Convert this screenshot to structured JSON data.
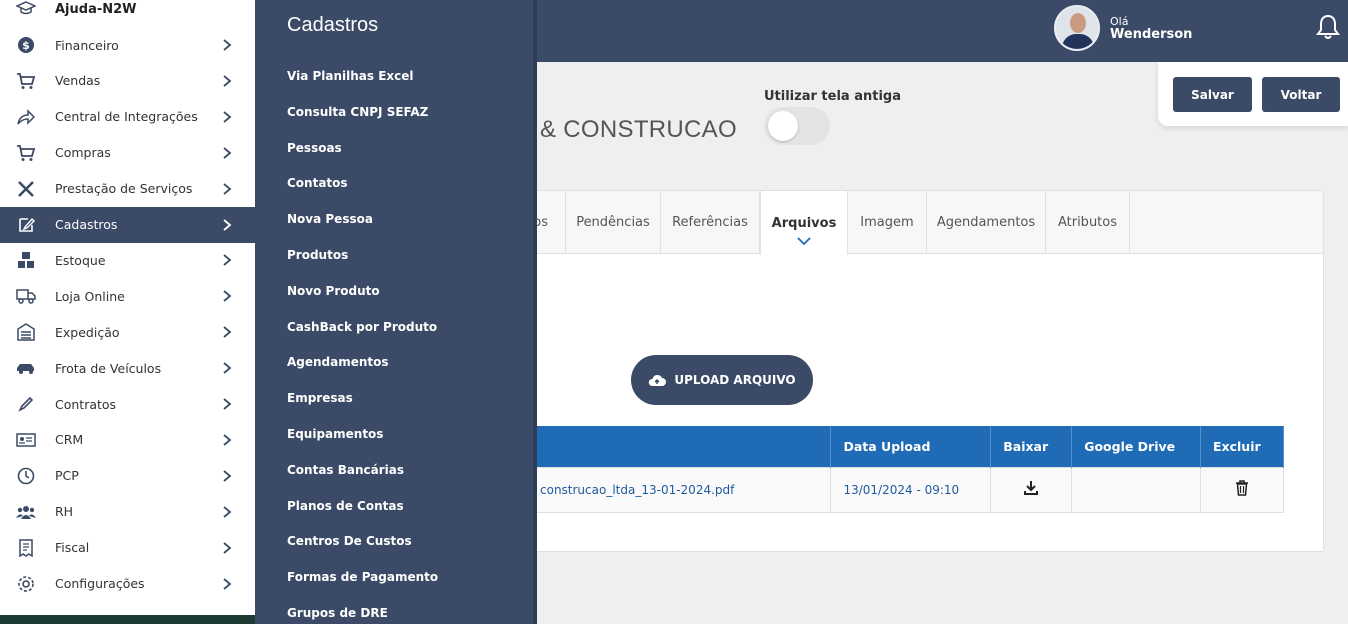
{
  "header": {
    "greeting": "Olá",
    "user_name": "Wenderson"
  },
  "actions": {
    "save_label": "Salvar",
    "back_label": "Voltar"
  },
  "page": {
    "company_title": "& CONSTRUCAO",
    "old_screen_label": "Utilizar tela antiga",
    "old_screen_enabled": false
  },
  "tabs": [
    {
      "label": "os"
    },
    {
      "label": "Pendências"
    },
    {
      "label": "Referências"
    },
    {
      "label": "Arquivos",
      "active": true
    },
    {
      "label": "Imagem"
    },
    {
      "label": "Agendamentos"
    },
    {
      "label": "Atributos"
    }
  ],
  "files": {
    "upload_label": "UPLOAD ARQUIVO",
    "columns": [
      "",
      "Data Upload",
      "Baixar",
      "Google Drive",
      "Excluir"
    ],
    "rows": [
      {
        "name": "construcao_ltda_13-01-2024.pdf",
        "date": "13/01/2024 - 09:10"
      }
    ]
  },
  "sidebar": {
    "brand": "Ajuda-N2W",
    "items": [
      {
        "label": "Financeiro",
        "icon": "dollar-icon"
      },
      {
        "label": "Vendas",
        "icon": "cart-icon"
      },
      {
        "label": "Central de Integrações",
        "icon": "share-icon"
      },
      {
        "label": "Compras",
        "icon": "cart-icon"
      },
      {
        "label": "Prestação de Serviços",
        "icon": "tools-icon"
      },
      {
        "label": "Cadastros",
        "icon": "edit-icon",
        "active": true
      },
      {
        "label": "Estoque",
        "icon": "boxes-icon"
      },
      {
        "label": "Loja Online",
        "icon": "truck-icon"
      },
      {
        "label": "Expedição",
        "icon": "warehouse-icon"
      },
      {
        "label": "Frota de Veículos",
        "icon": "car-icon"
      },
      {
        "label": "Contratos",
        "icon": "pen-icon"
      },
      {
        "label": "CRM",
        "icon": "id-card-icon"
      },
      {
        "label": "PCP",
        "icon": "clock-icon"
      },
      {
        "label": "RH",
        "icon": "users-icon"
      },
      {
        "label": "Fiscal",
        "icon": "receipt-icon"
      },
      {
        "label": "Configurações",
        "icon": "gear-icon"
      }
    ]
  },
  "submenu": {
    "title": "Cadastros",
    "items": [
      "Via Planilhas Excel",
      "Consulta CNPJ SEFAZ",
      "Pessoas",
      "Contatos",
      "Nova Pessoa",
      "Produtos",
      "Novo Produto",
      "CashBack por Produto",
      "Agendamentos",
      "Empresas",
      "Equipamentos",
      "Contas Bancárias",
      "Planos de Contas",
      "Centros De Custos",
      "Formas de Pagamento",
      "Grupos de DRE"
    ]
  }
}
